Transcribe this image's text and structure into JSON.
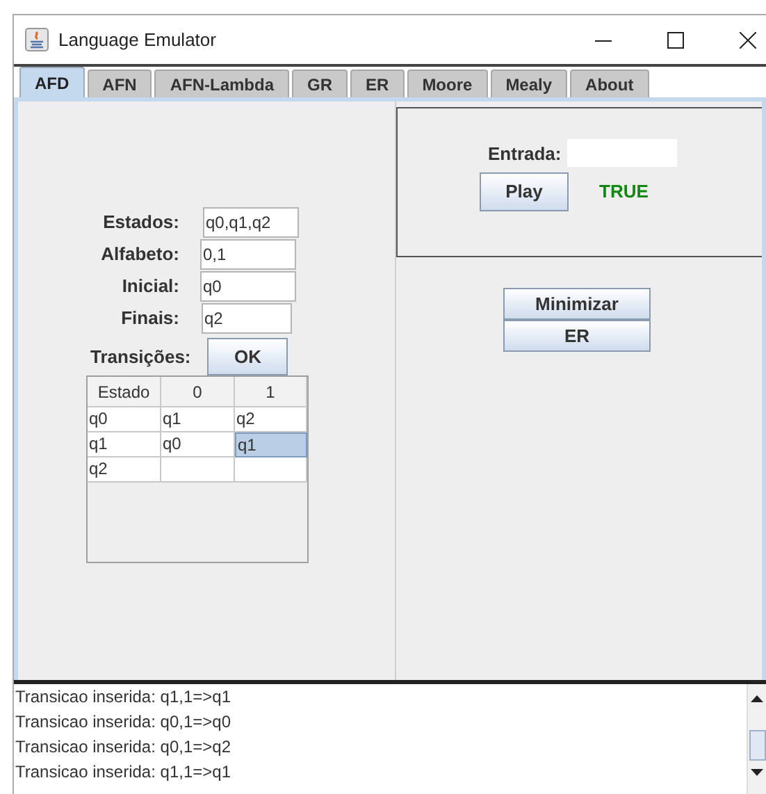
{
  "window": {
    "title": "Language Emulator"
  },
  "tabs": [
    {
      "label": "AFD",
      "selected": true
    },
    {
      "label": "AFN",
      "selected": false
    },
    {
      "label": "AFN-Lambda",
      "selected": false
    },
    {
      "label": "GR",
      "selected": false
    },
    {
      "label": "ER",
      "selected": false
    },
    {
      "label": "Moore",
      "selected": false
    },
    {
      "label": "Mealy",
      "selected": false
    },
    {
      "label": "About",
      "selected": false
    }
  ],
  "fields": [
    {
      "label": "Estados:",
      "value": "q0,q1,q2"
    },
    {
      "label": "Alfabeto:",
      "value": "0,1"
    },
    {
      "label": "Inicial:",
      "value": "q0"
    },
    {
      "label": "Finais:",
      "value": "q2"
    }
  ],
  "transitions": {
    "label": "Transições:",
    "button": "OK"
  },
  "table": {
    "columns": [
      "Estado",
      "0",
      "1"
    ],
    "rows": [
      [
        {
          "text": "q0",
          "selected": false
        },
        {
          "text": "q1",
          "selected": false
        },
        {
          "text": "q2",
          "selected": false
        }
      ],
      [
        {
          "text": "q1",
          "selected": false
        },
        {
          "text": "q0",
          "selected": false
        },
        {
          "text": "q1",
          "selected": true
        }
      ],
      [
        {
          "text": "q2",
          "selected": false
        },
        {
          "selected": false
        },
        {
          "selected": false
        }
      ]
    ]
  },
  "simulation": {
    "input_label": "Entrada:",
    "play_button": "Play",
    "result": "TRUE"
  },
  "actions": [
    "Minimizar",
    "ER"
  ],
  "log": [
    "Transicao inserida: q1,1=>q1",
    "Transicao inserida: q0,1=>q0",
    "Transicao inserida: q0,1=>q2",
    "Transicao inserida: q1,1=>q1"
  ]
}
